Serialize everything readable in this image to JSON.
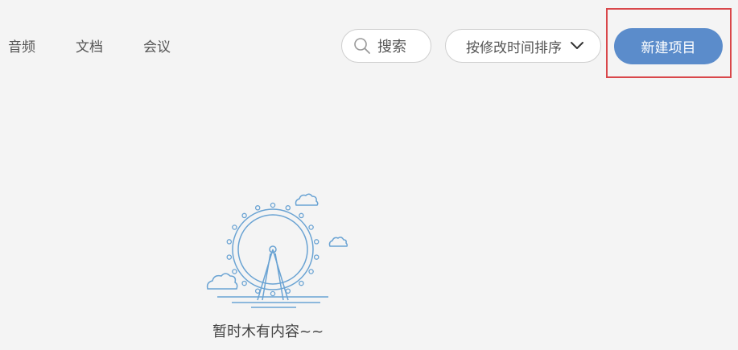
{
  "nav": {
    "tabs": [
      {
        "label": "音频"
      },
      {
        "label": "文档"
      },
      {
        "label": "会议"
      }
    ]
  },
  "toolbar": {
    "search_label": "搜索",
    "sort_label": "按修改时间排序",
    "new_project_label": "新建项目"
  },
  "empty_state": {
    "message": "暂时木有内容~~",
    "illustration_icon": "ferris-wheel-icon"
  },
  "colors": {
    "accent": "#5b8ccb",
    "highlight": "#d9474a",
    "illustration": "#6aa3d3"
  }
}
